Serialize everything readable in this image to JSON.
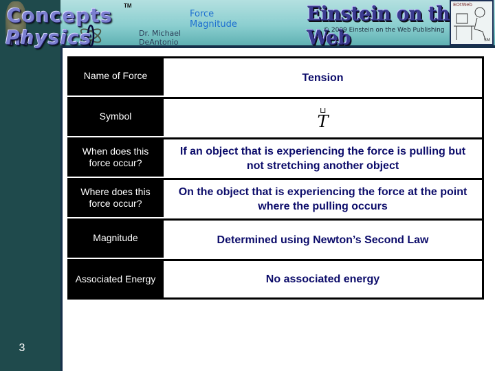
{
  "header": {
    "logo_line1": "Concepts in",
    "logo_line2": "Physics",
    "logo_tm": "TM",
    "author_line1": "Dr. Michael",
    "author_line2": "DeAntonio",
    "slide_title_line1": "Force",
    "slide_title_line2": "Magnitude",
    "brand": "Einstein on the Web",
    "copyright": "© 2009 Einstein on the Web Publishing",
    "cartoon_label": "EOtWeb",
    "cartoon_signature": "SM"
  },
  "table": {
    "rows": [
      {
        "label": "Name of Force",
        "value": "Tension"
      },
      {
        "label": "Symbol",
        "value": "T",
        "value_type": "vector-symbol"
      },
      {
        "label": "When does this force occur?",
        "value": "If an object that is experiencing the force is pulling but not stretching another object"
      },
      {
        "label": "Where does this force occur?",
        "value": "On the object that is experiencing the force at the point where the pulling occurs"
      },
      {
        "label": "Magnitude",
        "value": "Determined using Newton’s Second Law"
      },
      {
        "label": "Associated Energy",
        "value": "No associated energy"
      }
    ]
  },
  "footer": {
    "page_number": "3"
  },
  "colors": {
    "sidebar": "#1f4a4c",
    "label_bg": "#000000",
    "value_text": "#0c0c6a",
    "title_text": "#1d6fd0"
  }
}
